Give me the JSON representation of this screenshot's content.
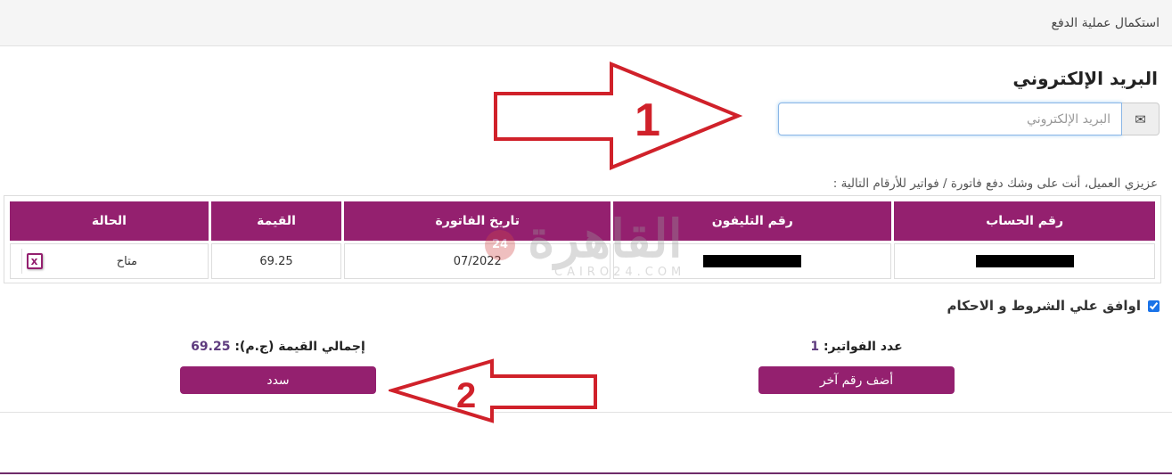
{
  "header": {
    "title": "استكمال عملية الدفع"
  },
  "email": {
    "label": "البريد الإلكتروني",
    "placeholder": "البريد الإلكتروني",
    "icon": "envelope-icon"
  },
  "notice": "عزيزي العميل، أنت على وشك دفع فاتورة / فواتير للأرقام التالية :",
  "table": {
    "columns": [
      "رقم الحساب",
      "رقم التليفون",
      "تاريخ الفاتورة",
      "القيمة",
      "الحالة"
    ],
    "rows": [
      {
        "account": "",
        "phone": "",
        "date": "07/2022",
        "amount": "69.25",
        "status": "متاح"
      }
    ]
  },
  "watermark": {
    "text": "القاهرة",
    "sub": "CAIRO24.COM",
    "badge": "24"
  },
  "terms": {
    "label": "اوافق علي الشروط و الاحكام",
    "checked": true
  },
  "summary": {
    "count_label": "عدد الفواتير:",
    "count_value": "1",
    "total_label": "إجمالي القيمة (ج.م):",
    "total_value": "69.25"
  },
  "buttons": {
    "add_number": "أضف رقم آخر",
    "pay": "سدد"
  },
  "annotations": {
    "arrow1_label": "1",
    "arrow2_label": "2"
  },
  "colors": {
    "brand": "#94206f",
    "annotation": "#d0212a"
  }
}
